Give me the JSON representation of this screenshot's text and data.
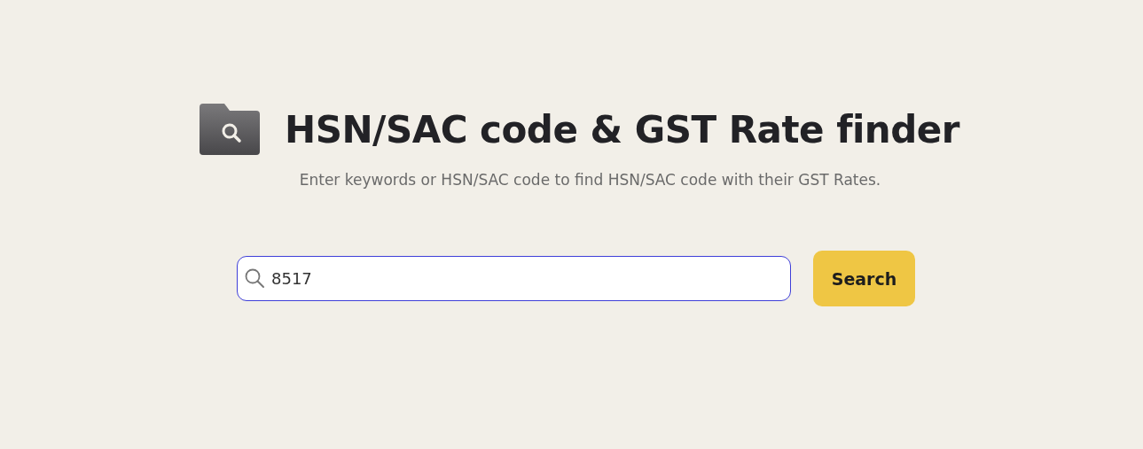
{
  "header": {
    "title": "HSN/SAC code & GST Rate finder",
    "subtitle": "Enter keywords or HSN/SAC code to find HSN/SAC code with their GST Rates."
  },
  "search": {
    "value": "8517",
    "focused": true,
    "button": "Search"
  }
}
